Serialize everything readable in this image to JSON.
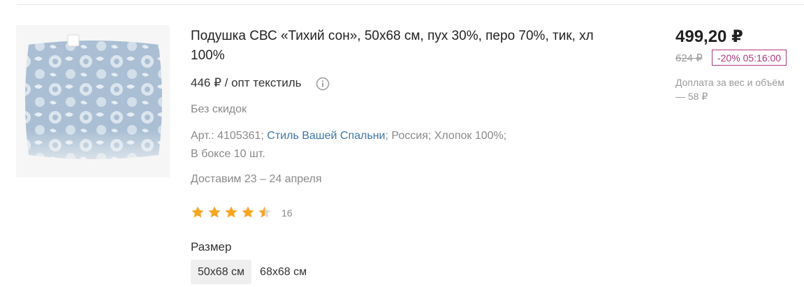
{
  "product": {
    "title": "Подушка СВС «Тихий сон», 50х68 см, пух 30%, перо 70%, тик, хл 100%",
    "wholesale_price": "446 ₽ / опт текстиль",
    "no_discount": "Без скидок",
    "article_label": "Арт.: 4105361;",
    "brand": "Стиль Вашей Спальни",
    "country_material": "; Россия; Хлопок 100%;",
    "box_qty": "В боксе 10 шт.",
    "delivery": "Доставим 23 – 24 апреля",
    "rating": 4.5,
    "review_count": "16",
    "size_label": "Размер",
    "sizes": [
      {
        "label": "50х68 см",
        "selected": true
      },
      {
        "label": "68х68 см",
        "selected": false
      }
    ]
  },
  "pricing": {
    "price": "499,20 ₽",
    "old_price": "624 ₽",
    "discount_badge": "-20% 05:16:00",
    "surcharge": "Доплата за вес и объём — 58 ₽"
  },
  "colors": {
    "star": "#f5a623",
    "star_empty": "#d8d8d8",
    "brand_link": "#3e77aa",
    "badge": "#b0367c"
  },
  "icons": {
    "info": "info-icon",
    "star": "star-icon"
  }
}
